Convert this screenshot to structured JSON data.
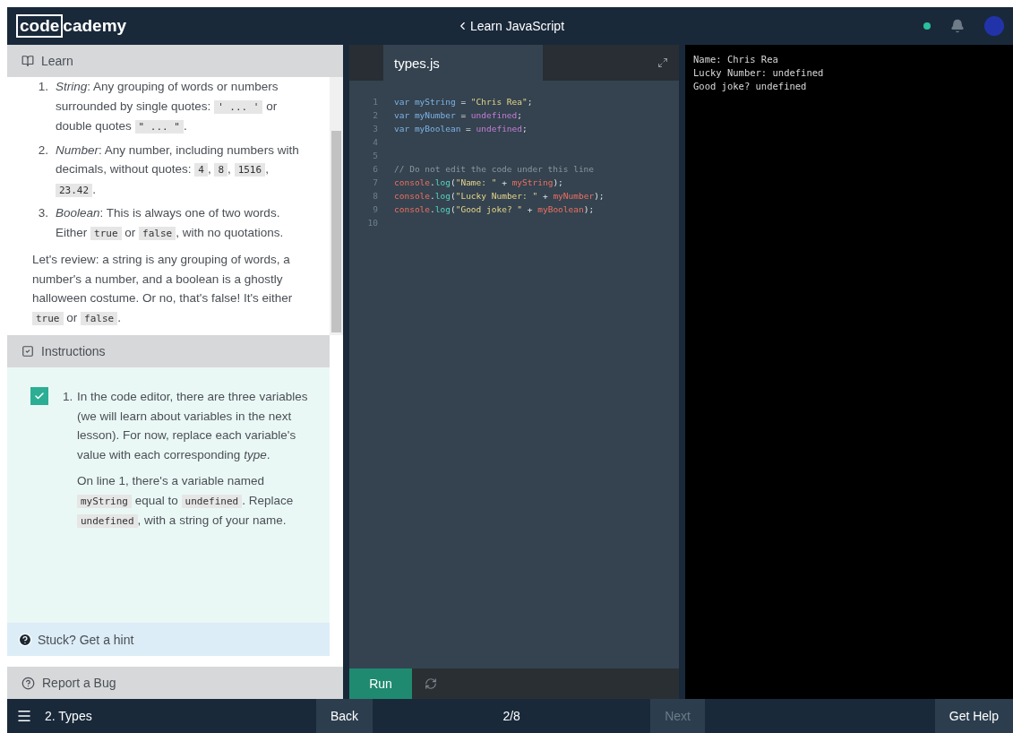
{
  "header": {
    "logo_box": "code",
    "logo_rest": "cademy",
    "course": "Learn JavaScript"
  },
  "learn": {
    "title": "Learn",
    "list": [
      {
        "number": "1.",
        "segments": [
          {
            "kind": "em",
            "text": "String"
          },
          {
            "kind": "text",
            "text": ": Any grouping of words or numbers surrounded by single quotes: "
          },
          {
            "kind": "code",
            "text": "' ... '"
          },
          {
            "kind": "text",
            "text": " or double quotes "
          },
          {
            "kind": "code",
            "text": "\" ... \""
          },
          {
            "kind": "text",
            "text": "."
          }
        ]
      },
      {
        "number": "2.",
        "segments": [
          {
            "kind": "em",
            "text": "Number"
          },
          {
            "kind": "text",
            "text": ": Any number, including numbers with decimals, without quotes: "
          },
          {
            "kind": "code",
            "text": "4"
          },
          {
            "kind": "text",
            "text": ", "
          },
          {
            "kind": "code",
            "text": "8"
          },
          {
            "kind": "text",
            "text": ", "
          },
          {
            "kind": "code",
            "text": "1516"
          },
          {
            "kind": "text",
            "text": ", "
          },
          {
            "kind": "code",
            "text": "23.42"
          },
          {
            "kind": "text",
            "text": "."
          }
        ]
      },
      {
        "number": "3.",
        "segments": [
          {
            "kind": "em",
            "text": "Boolean"
          },
          {
            "kind": "text",
            "text": ": This is always one of two words. Either "
          },
          {
            "kind": "code",
            "text": "true"
          },
          {
            "kind": "text",
            "text": " or "
          },
          {
            "kind": "code",
            "text": "false"
          },
          {
            "kind": "text",
            "text": ", with no quotations."
          }
        ]
      }
    ],
    "paragraphs": [
      [
        {
          "kind": "text",
          "text": "Let's review: a string is any grouping of words, a number's a number, and a boolean is a ghostly halloween costume. Or no, that's false! It's either "
        },
        {
          "kind": "code",
          "text": "true"
        },
        {
          "kind": "text",
          "text": " or "
        },
        {
          "kind": "code",
          "text": "false"
        },
        {
          "kind": "text",
          "text": "."
        }
      ]
    ]
  },
  "instructions": {
    "title": "Instructions",
    "tasks": [
      {
        "number": "1.",
        "checked": true,
        "paragraphs": [
          [
            {
              "kind": "text",
              "text": "In the code editor, there are three variables (we will learn about variables in the next lesson). For now, replace each variable's value with each corresponding "
            },
            {
              "kind": "em",
              "text": "type"
            },
            {
              "kind": "text",
              "text": "."
            }
          ],
          [
            {
              "kind": "text",
              "text": "On line 1, there's a variable named "
            },
            {
              "kind": "code",
              "text": "myString"
            },
            {
              "kind": "text",
              "text": " equal to "
            },
            {
              "kind": "code",
              "text": "undefined"
            },
            {
              "kind": "text",
              "text": ". Replace "
            },
            {
              "kind": "code",
              "text": "undefined"
            },
            {
              "kind": "text",
              "text": ", with a string of your name."
            }
          ]
        ]
      }
    ],
    "hint": "Stuck? Get a hint",
    "report": "Report a Bug"
  },
  "editor": {
    "tab": "types.js",
    "lines": [
      {
        "number": "1",
        "tokens": [
          {
            "kind": "keyword",
            "text": "var "
          },
          {
            "kind": "var",
            "text": "myString"
          },
          {
            "kind": "plain",
            "text": " = "
          },
          {
            "kind": "string",
            "text": "\"Chris Rea\""
          },
          {
            "kind": "plain",
            "text": ";"
          }
        ]
      },
      {
        "number": "2",
        "tokens": [
          {
            "kind": "keyword",
            "text": "var "
          },
          {
            "kind": "var",
            "text": "myNumber"
          },
          {
            "kind": "plain",
            "text": " = "
          },
          {
            "kind": "undefined",
            "text": "undefined"
          },
          {
            "kind": "plain",
            "text": ";"
          }
        ]
      },
      {
        "number": "3",
        "tokens": [
          {
            "kind": "keyword",
            "text": "var "
          },
          {
            "kind": "var",
            "text": "myBoolean"
          },
          {
            "kind": "plain",
            "text": " = "
          },
          {
            "kind": "undefined",
            "text": "undefined"
          },
          {
            "kind": "plain",
            "text": ";"
          }
        ]
      },
      {
        "number": "4"
      },
      {
        "number": "5"
      },
      {
        "number": "6",
        "tokens": [
          {
            "kind": "comment",
            "text": "// Do not edit the code under this line"
          }
        ]
      },
      {
        "number": "7",
        "tokens": [
          {
            "kind": "object",
            "text": "console"
          },
          {
            "kind": "plain",
            "text": "."
          },
          {
            "kind": "method",
            "text": "log"
          },
          {
            "kind": "plain",
            "text": "("
          },
          {
            "kind": "string",
            "text": "\"Name: \""
          },
          {
            "kind": "plain",
            "text": " + "
          },
          {
            "kind": "object",
            "text": "myString"
          },
          {
            "kind": "plain",
            "text": ");"
          }
        ]
      },
      {
        "number": "8",
        "tokens": [
          {
            "kind": "object",
            "text": "console"
          },
          {
            "kind": "plain",
            "text": "."
          },
          {
            "kind": "method",
            "text": "log"
          },
          {
            "kind": "plain",
            "text": "("
          },
          {
            "kind": "string",
            "text": "\"Lucky Number: \""
          },
          {
            "kind": "plain",
            "text": " + "
          },
          {
            "kind": "object",
            "text": "myNumber"
          },
          {
            "kind": "plain",
            "text": ");"
          }
        ]
      },
      {
        "number": "9",
        "tokens": [
          {
            "kind": "object",
            "text": "console"
          },
          {
            "kind": "plain",
            "text": "."
          },
          {
            "kind": "method",
            "text": "log"
          },
          {
            "kind": "plain",
            "text": "("
          },
          {
            "kind": "string",
            "text": "\"Good joke? \""
          },
          {
            "kind": "plain",
            "text": " + "
          },
          {
            "kind": "object",
            "text": "myBoolean"
          },
          {
            "kind": "plain",
            "text": ");"
          }
        ]
      },
      {
        "number": "10"
      }
    ],
    "run": "Run"
  },
  "output": [
    "Name: Chris Rea",
    "Lucky Number: undefined",
    "Good joke? undefined"
  ],
  "footer": {
    "lesson": "2. Types",
    "back": "Back",
    "progress": "2/8",
    "next": {
      "label": "Next",
      "disabled": true
    },
    "help": "Get Help"
  }
}
